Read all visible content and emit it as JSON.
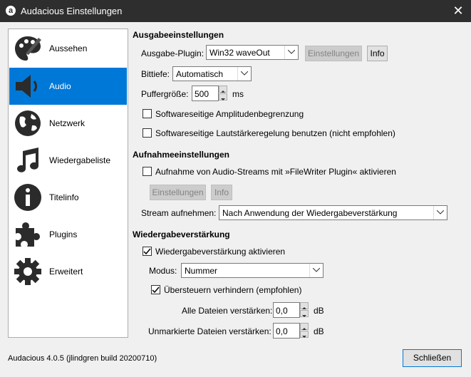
{
  "window": {
    "title": "Audacious Einstellungen",
    "close_icon": "close-icon"
  },
  "sidebar": {
    "items": [
      {
        "label": "Aussehen",
        "icon": "palette-icon"
      },
      {
        "label": "Audio",
        "icon": "speaker-icon",
        "selected": true
      },
      {
        "label": "Netzwerk",
        "icon": "globe-icon"
      },
      {
        "label": "Wiedergabeliste",
        "icon": "music-note-icon"
      },
      {
        "label": "Titelinfo",
        "icon": "info-icon"
      },
      {
        "label": "Plugins",
        "icon": "puzzle-icon"
      },
      {
        "label": "Erweitert",
        "icon": "gear-icon"
      }
    ]
  },
  "output": {
    "heading": "Ausgabeeinstellungen",
    "plugin_label": "Ausgabe-Plugin:",
    "plugin_value": "Win32 waveOut",
    "settings_button": "Einstellungen",
    "info_button": "Info",
    "bitdepth_label": "Bittiefe:",
    "bitdepth_value": "Automatisch",
    "buffer_label": "Puffergröße:",
    "buffer_value": "500",
    "buffer_unit": "ms",
    "soft_clip_label": "Softwareseitige Amplitudenbegrenzung",
    "soft_clip_checked": false,
    "soft_volume_label": "Softwareseitige Lautstärkeregelung benutzen (nicht empfohlen)",
    "soft_volume_checked": false
  },
  "recording": {
    "heading": "Aufnahmeeinstellungen",
    "record_label": "Aufnahme von Audio-Streams mit »FileWriter Plugin« aktivieren",
    "record_checked": false,
    "settings_button": "Einstellungen",
    "info_button": "Info",
    "stream_label": "Stream aufnehmen:",
    "stream_value": "Nach Anwendung der Wiedergabeverstärkung"
  },
  "replaygain": {
    "heading": "Wiedergabeverstärkung",
    "enable_label": "Wiedergabeverstärkung aktivieren",
    "enable_checked": true,
    "mode_label": "Modus:",
    "mode_value": "Nummer",
    "prevent_clip_label": "Übersteuern verhindern (empfohlen)",
    "prevent_clip_checked": true,
    "all_files_label": "Alle Dateien verstärken:",
    "all_files_value": "0,0",
    "all_files_unit": "dB",
    "untagged_label": "Unmarkierte Dateien verstärken:",
    "untagged_value": "0,0",
    "untagged_unit": "dB"
  },
  "footer": {
    "version": "Audacious 4.0.5 (jlindgren build 20200710)",
    "close_button": "Schließen"
  },
  "colors": {
    "selection": "#0078d7",
    "titlebar": "#2e2e2e"
  }
}
